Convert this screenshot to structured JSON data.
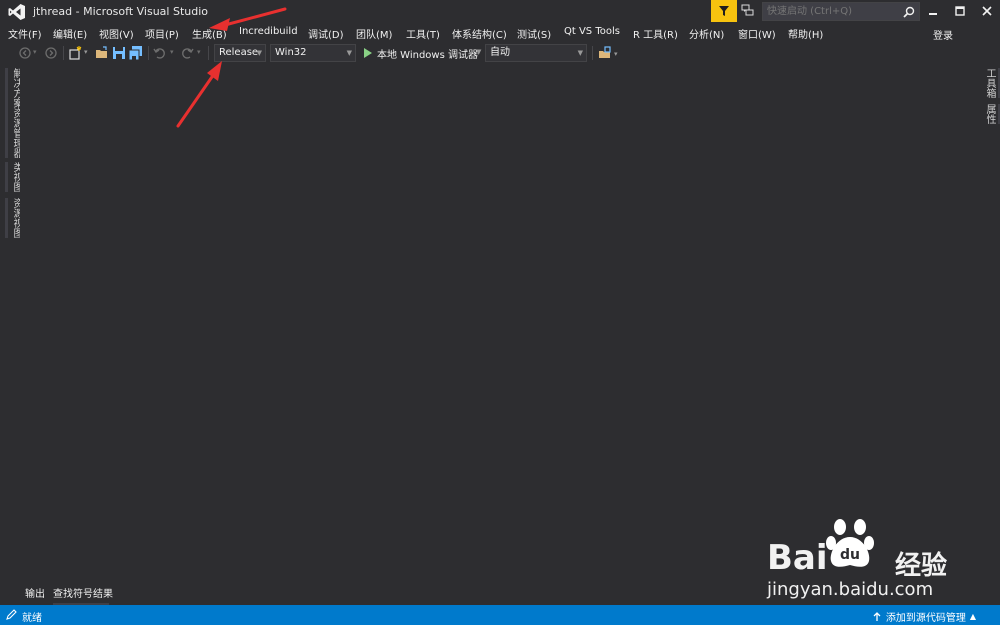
{
  "window": {
    "title": "jthread - Microsoft Visual Studio",
    "quick_launch_placeholder": "快速启动 (Ctrl+Q)",
    "login_label": "登录"
  },
  "menu": [
    "文件(F)",
    "编辑(E)",
    "视图(V)",
    "项目(P)",
    "生成(B)",
    "Incredibuild",
    "调试(D)",
    "团队(M)",
    "工具(T)",
    "体系结构(C)",
    "测试(S)",
    "Qt VS Tools",
    "R 工具(R)",
    "分析(N)",
    "窗口(W)",
    "帮助(H)"
  ],
  "toolbar": {
    "configuration": "Release",
    "platform": "Win32",
    "run_target": "本地 Windows 调试器",
    "run_mode": "自动"
  },
  "left_tabs": [
    "解决方案资源管理器",
    "类视图",
    "资源视图"
  ],
  "right_tabs": [
    "工具箱",
    "属性"
  ],
  "bottom_tabs": [
    "输出",
    "查找符号结果"
  ],
  "status": {
    "ready": "就绪",
    "source_control": "添加到源代码管理"
  },
  "watermark": {
    "brand": "Bai",
    "brand_cn": "经验",
    "url": "jingyan.baidu.com"
  },
  "colors": {
    "background": "#2d2d30",
    "status_bar": "#007acc",
    "filter_button": "#f7c30f",
    "annotation": "#e8302f"
  }
}
